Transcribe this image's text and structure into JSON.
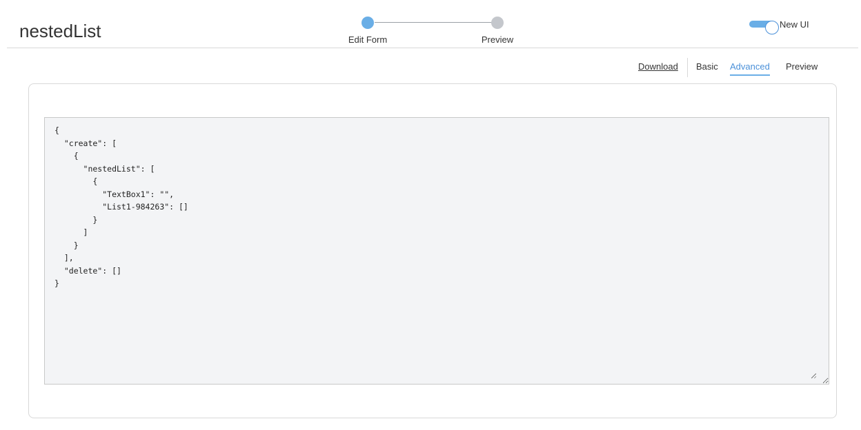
{
  "page": {
    "title": "nestedList"
  },
  "stepper": {
    "steps": [
      {
        "label": "Edit Form",
        "state": "active"
      },
      {
        "label": "Preview",
        "state": "inactive"
      }
    ]
  },
  "toggle": {
    "label": "New UI",
    "on": true
  },
  "tabs": {
    "download": "Download",
    "basic": "Basic",
    "advanced": "Advanced",
    "preview": "Preview",
    "active": "advanced"
  },
  "editor": {
    "content": "{\n  \"create\": [\n    {\n      \"nestedList\": [\n        {\n          \"TextBox1\": \"\",\n          \"List1-984263\": []\n        }\n      ]\n    }\n  ],\n  \"delete\": []\n}"
  },
  "colors": {
    "accent": "#4a90d9",
    "step_active": "#6aaee6",
    "step_inactive": "#c4c7cc",
    "toggle_track": "#6aaee6"
  }
}
